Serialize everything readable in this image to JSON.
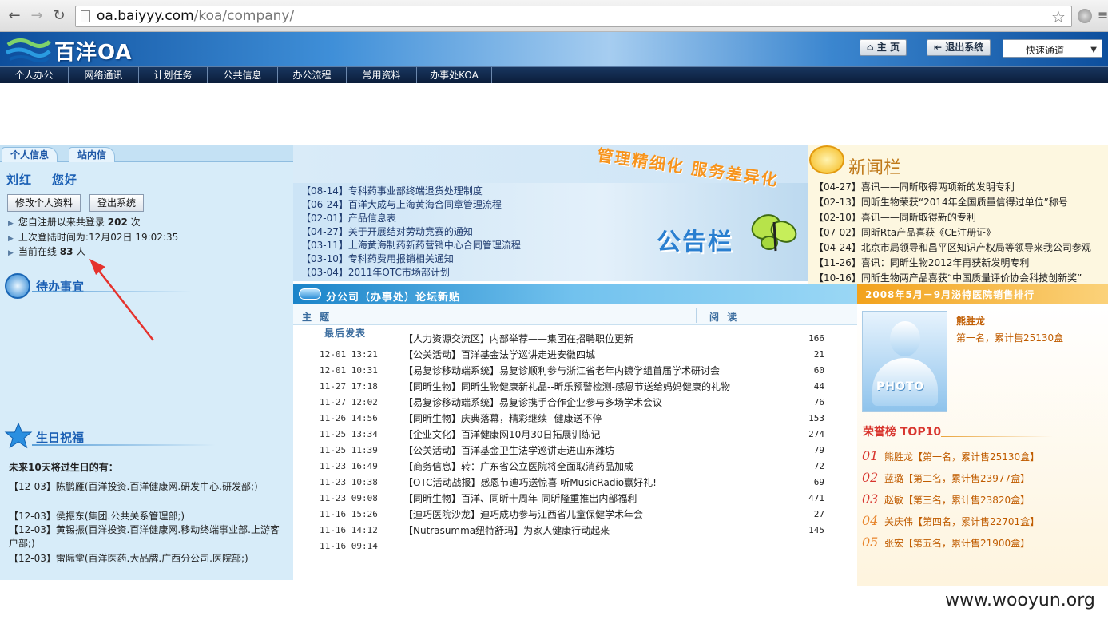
{
  "browser": {
    "url_domain": "oa.baiyyy.com",
    "url_path": "/koa/company/"
  },
  "header": {
    "logo_text": "百洋OA",
    "home_label": "主 页",
    "logout_label": "退出系统",
    "quick_channel_label": "快速通道"
  },
  "menu": {
    "items": [
      "个人办公",
      "网络通讯",
      "计划任务",
      "公共信息",
      "办公流程",
      "常用资料",
      "办事处KOA"
    ]
  },
  "left": {
    "tabs": [
      "个人信息",
      "站内信"
    ],
    "user_name": "刘红",
    "greeting": "您好",
    "edit_profile_label": "修改个人资料",
    "logout_label": "登出系统",
    "stats": {
      "login_prefix": "您自注册以来共登录",
      "login_count": "202",
      "login_suffix": "次",
      "last_login_label": "上次登陆时间为:12月02日 19:02:35",
      "online_prefix": "当前在线",
      "online_count": "83",
      "online_suffix": "人"
    },
    "todo_title": "待办事宜",
    "birthday_title": "生日祝福",
    "birthday_heading": "未来10天将过生日的有：",
    "birthday_items": [
      "【12-03】陈鹏雁(百洋投资.百洋健康网.研发中心.研发部;)",
      "【12-03】侯振东(集团.公共关系管理部;)",
      "【12-03】黄锡振(百洋投资.百洋健康网.移动终端事业部.上游客户部;)",
      "【12-03】雷际堂(百洋医药.大品牌.广西分公司.医院部;)"
    ]
  },
  "announcements": {
    "slogan": "管理精细化 服务差异化",
    "label": "公告栏",
    "items": [
      {
        "date": "【08-14】",
        "title": "专科药事业部终端退货处理制度"
      },
      {
        "date": "【06-24】",
        "title": "百洋大成与上海黄海合同章管理流程"
      },
      {
        "date": "【02-01】",
        "title": "产品信息表"
      },
      {
        "date": "【04-27】",
        "title": "关于开展结对劳动竞赛的通知"
      },
      {
        "date": "【03-11】",
        "title": "上海黄海制药新药营销中心合同管理流程"
      },
      {
        "date": "【03-10】",
        "title": "专科药费用报销相关通知"
      },
      {
        "date": "【03-04】",
        "title": "2011年OTC市场部计划"
      }
    ]
  },
  "news": {
    "title": "新闻栏",
    "items": [
      "【04-27】喜讯——同昕取得两项新的发明专利",
      "【02-13】同昕生物荣获“2014年全国质量信得过单位”称号",
      "【02-10】喜讯——同昕取得新的专利",
      "【07-02】同昕Rta产品喜获《CE注册证》",
      "【04-24】北京市局领导和昌平区知识产权局等领导来我公司参观",
      "【11-26】喜讯：同昕生物2012年再获新发明专利",
      "【10-16】同昕生物两产品喜获“中国质量评价协会科技创新奖”"
    ]
  },
  "forum": {
    "title": "分公司（办事处）论坛新贴",
    "col_subject": "主 题",
    "col_reads": "阅 读",
    "col_last": "最后发表",
    "rows": [
      {
        "date": "",
        "title": "【人力资源交流区】内部举荐——集团在招聘职位更新",
        "count": "166"
      },
      {
        "date": "12-01 13:21",
        "title": "【公关活动】百洋基金法学巡讲走进安徽四城",
        "count": "21"
      },
      {
        "date": "12-01 10:31",
        "title": "【易复诊移动端系统】易复诊顺利参与浙江省老年内镜学组首届学术研讨会",
        "count": "60"
      },
      {
        "date": "11-27 17:18",
        "title": "【同昕生物】同昕生物健康新礼品--昕乐预警检测-感恩节送给妈妈健康的礼物",
        "count": "44"
      },
      {
        "date": "11-27 12:02",
        "title": "【易复诊移动端系统】易复诊携手合作企业参与多场学术会议",
        "count": "76"
      },
      {
        "date": "11-26 14:56",
        "title": "【同昕生物】庆典落幕，精彩继续--健康送不停",
        "count": "153"
      },
      {
        "date": "11-25 13:34",
        "title": "【企业文化】百洋健康网10月30日拓展训练记",
        "count": "274"
      },
      {
        "date": "11-25 11:39",
        "title": "【公关活动】百洋基金卫生法学巡讲走进山东潍坊",
        "count": "79"
      },
      {
        "date": "11-23 16:49",
        "title": "【商务信息】转：广东省公立医院将全面取消药品加成",
        "count": "72"
      },
      {
        "date": "11-23 10:38",
        "title": "【OTC活动战报】感恩节迪巧送惊喜 听MusicRadio赢好礼!",
        "count": "69"
      },
      {
        "date": "11-23 09:08",
        "title": "【同昕生物】百洋、同昕十周年-同昕隆重推出内部福利",
        "count": "471"
      },
      {
        "date": "11-16 15:26",
        "title": "【迪巧医院沙龙】迪巧成功参与江西省儿童保健学术年会",
        "count": "27"
      },
      {
        "date": "11-16 14:12",
        "title": "【Nutrasumma纽特舒玛】为家人健康行动起来",
        "count": "145"
      },
      {
        "date": "11-16 09:14",
        "title": "",
        "count": ""
      }
    ]
  },
  "ranking": {
    "title": "2008年5月－9月泌特医院销售排行",
    "photo_label": "PHOTO",
    "top_name": "熊胜龙",
    "top_desc": "第一名，累计售25130盒",
    "honor_title": "荣誉榜 TOP10",
    "entries": [
      {
        "num": "01",
        "text": "熊胜龙【第一名，累计售25130盒】"
      },
      {
        "num": "02",
        "text": "蓝璐【第二名，累计售23977盒】"
      },
      {
        "num": "03",
        "text": "赵敏【第三名，累计售23820盒】"
      },
      {
        "num": "04",
        "text": "关庆伟【第四名，累计售22701盒】"
      },
      {
        "num": "05",
        "text": "张宏【第五名，累计售21900盒】"
      }
    ]
  },
  "watermark": "www.wooyun.org",
  "colors": {
    "accent_blue": "#1a5fb4",
    "accent_orange": "#f7941d",
    "rank_red": "#d8352e"
  }
}
